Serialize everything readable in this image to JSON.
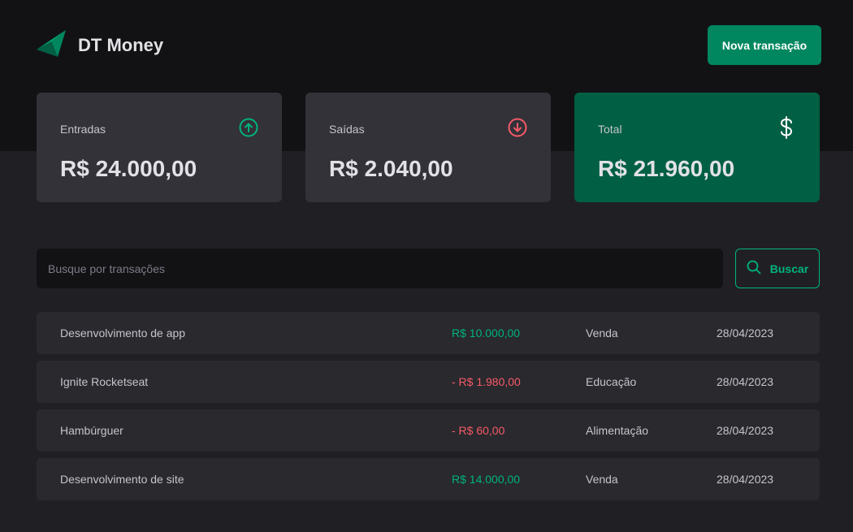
{
  "app": {
    "title": "DT Money",
    "new_transaction_label": "Nova transação"
  },
  "summary": {
    "income": {
      "label": "Entradas",
      "value": "R$ 24.000,00",
      "icon": "arrow-circle-up-icon"
    },
    "outcome": {
      "label": "Saídas",
      "value": "R$ 2.040,00",
      "icon": "arrow-circle-down-icon"
    },
    "total": {
      "label": "Total",
      "value": "R$ 21.960,00",
      "icon": "dollar-sign-icon"
    }
  },
  "search": {
    "placeholder": "Busque por transações",
    "value": "",
    "button_label": "Buscar"
  },
  "transactions": [
    {
      "description": "Desenvolvimento de app",
      "price": "R$ 10.000,00",
      "type": "income",
      "category": "Venda",
      "date": "28/04/2023"
    },
    {
      "description": "Ignite Rocketseat",
      "price": "- R$ 1.980,00",
      "type": "outcome",
      "category": "Educação",
      "date": "28/04/2023"
    },
    {
      "description": "Hambúrguer",
      "price": "- R$ 60,00",
      "type": "outcome",
      "category": "Alimentação",
      "date": "28/04/2023"
    },
    {
      "description": "Desenvolvimento de site",
      "price": "R$ 14.000,00",
      "type": "income",
      "category": "Venda",
      "date": "28/04/2023"
    }
  ],
  "colors": {
    "brand": "#00875f",
    "brand_light": "#00b37e",
    "income": "#00b37e",
    "outcome": "#f75a68",
    "total_card": "#015f43"
  }
}
